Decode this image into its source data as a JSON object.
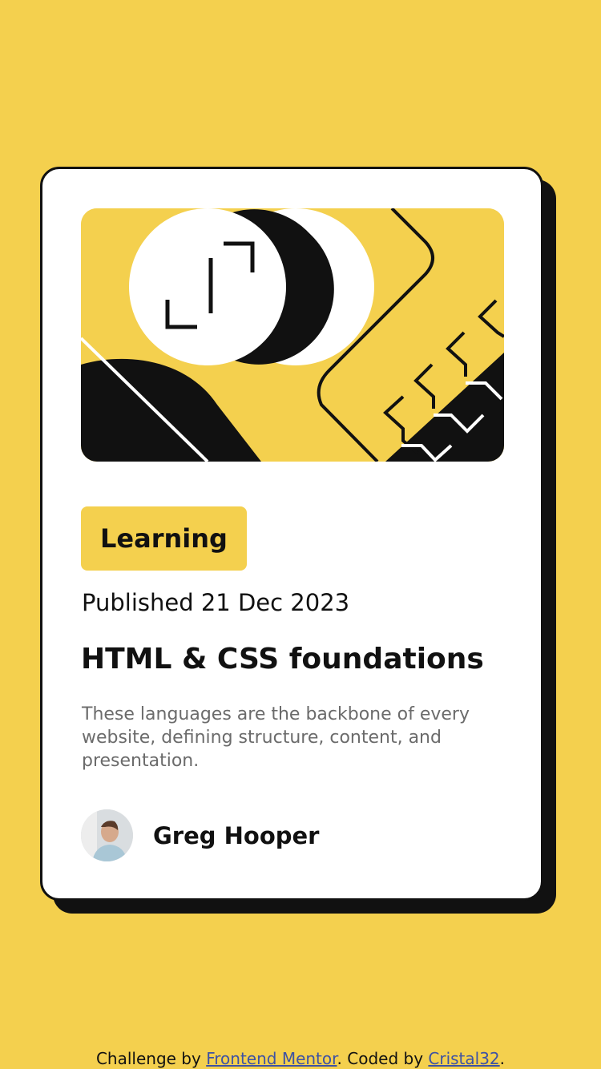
{
  "card": {
    "tag": "Learning",
    "published": "Published 21 Dec 2023",
    "title": "HTML & CSS foundations",
    "description": "These languages are the backbone of every website, defining structure, content, and presentation.",
    "author": {
      "name": "Greg Hooper",
      "avatar_icon": "avatar-photo"
    },
    "hero_icon": "code-brackets-illustration"
  },
  "footer": {
    "prefix": "Challenge by ",
    "link1": "Frontend Mentor",
    "middle": ". Coded by ",
    "link2": "Cristal32",
    "suffix": "."
  },
  "colors": {
    "background": "#F4D04E",
    "card": "#FFFFFF",
    "ink": "#111111",
    "muted": "#6B6B6B",
    "link": "#3E52A3"
  }
}
